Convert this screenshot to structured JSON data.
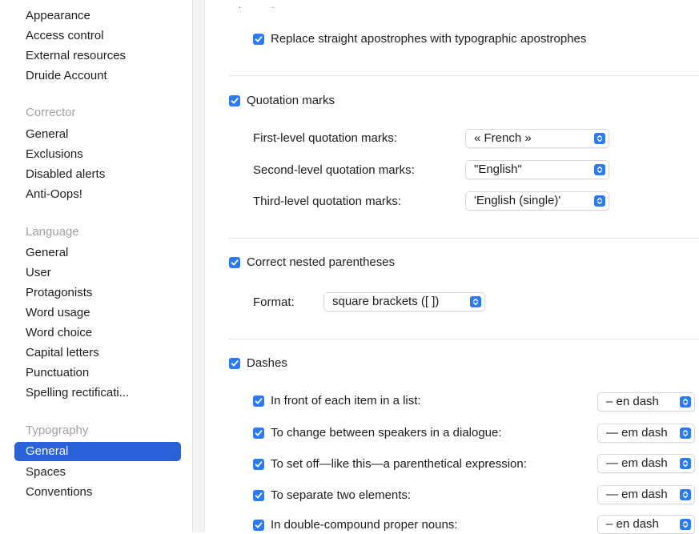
{
  "sidebar": {
    "top_items": [
      "Appearance",
      "Access control",
      "External resources",
      "Druide Account"
    ],
    "corrector": {
      "header": "Corrector",
      "items": [
        "General",
        "Exclusions",
        "Disabled alerts",
        "Anti-Oops!"
      ]
    },
    "language": {
      "header": "Language",
      "items": [
        "General",
        "User",
        "Protagonists",
        "Word usage",
        "Word choice",
        "Capital letters",
        "Punctuation",
        "Spelling rectificati..."
      ]
    },
    "typography": {
      "header": "Typography",
      "items": [
        "General",
        "Spaces",
        "Conventions"
      ],
      "selected": "General"
    }
  },
  "main": {
    "top_dots": ". .",
    "apostrophes_checkbox": {
      "label": "Replace straight apostrophes with typographic apostrophes",
      "checked": true
    },
    "quotation": {
      "checkbox": {
        "label": "Quotation marks",
        "checked": true
      },
      "first_label": "First-level quotation marks:",
      "first_value": "« French »",
      "second_label": "Second-level quotation marks:",
      "second_value": "\"English\"",
      "third_label": "Third-level quotation marks:",
      "third_value": "'English (single)'"
    },
    "parentheses": {
      "checkbox": {
        "label": "Correct nested parentheses",
        "checked": true
      },
      "format_label": "Format:",
      "format_value": "square brackets ([ ])"
    },
    "dashes": {
      "checkbox": {
        "label": "Dashes",
        "checked": true
      },
      "rows": [
        {
          "label": "In front of each item in a list:",
          "value": "– en dash",
          "checked": true
        },
        {
          "label": "To change between speakers in a dialogue:",
          "value": "— em dash",
          "checked": true
        },
        {
          "label": "To set off—like this—a parenthetical expression:",
          "value": "— em dash",
          "checked": true
        },
        {
          "label": "To separate two elements:",
          "value": "— em dash",
          "checked": true
        },
        {
          "label": "In double-compound proper nouns:",
          "value": "– en dash",
          "checked": true
        }
      ]
    }
  },
  "colors": {
    "accent": "#2a7af6",
    "selection": "#2962d9",
    "header_gray": "#a0a0a0"
  }
}
